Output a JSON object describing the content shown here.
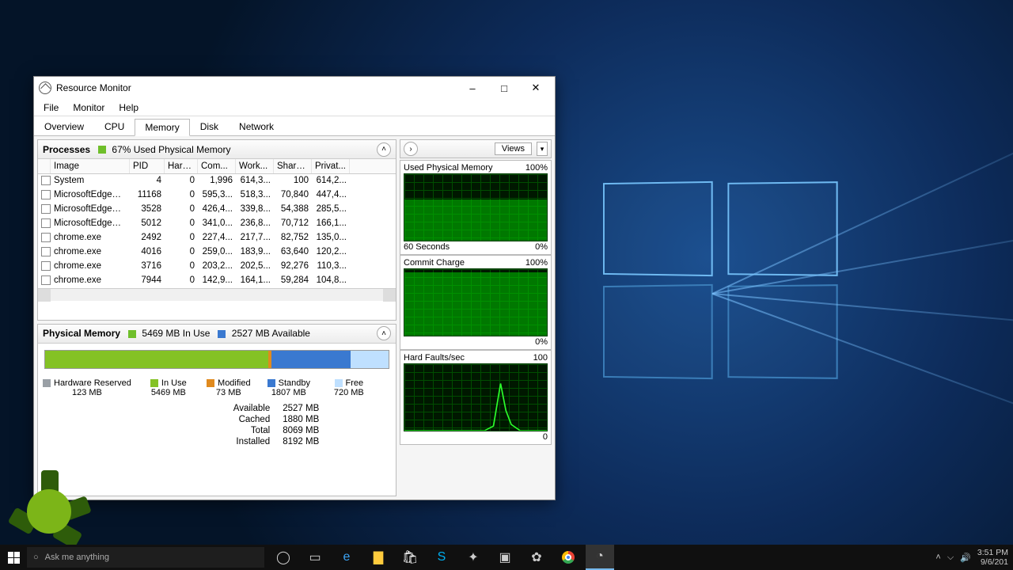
{
  "window": {
    "title": "Resource Monitor",
    "menu": [
      "File",
      "Monitor",
      "Help"
    ],
    "tabs": [
      "Overview",
      "CPU",
      "Memory",
      "Disk",
      "Network"
    ],
    "active_tab": 2,
    "controls": {
      "min": "–",
      "max": "□",
      "close": "✕"
    }
  },
  "processes_panel": {
    "title": "Processes",
    "summary": "67% Used Physical Memory",
    "badge_color": "#6fbf2a",
    "columns": [
      "Image",
      "PID",
      "Hard ...",
      "Com...",
      "Work...",
      "Share...",
      "Privat..."
    ],
    "rows": [
      {
        "img": "System",
        "pid": "4",
        "hard": "0",
        "com": "1,996",
        "work": "614,3...",
        "share": "100",
        "priv": "614,2..."
      },
      {
        "img": "MicrosoftEdgeCP.exe",
        "pid": "11168",
        "hard": "0",
        "com": "595,3...",
        "work": "518,3...",
        "share": "70,840",
        "priv": "447,4..."
      },
      {
        "img": "MicrosoftEdgeCP.exe",
        "pid": "3528",
        "hard": "0",
        "com": "426,4...",
        "work": "339,8...",
        "share": "54,388",
        "priv": "285,5..."
      },
      {
        "img": "MicrosoftEdgeCP.exe",
        "pid": "5012",
        "hard": "0",
        "com": "341,0...",
        "work": "236,8...",
        "share": "70,712",
        "priv": "166,1..."
      },
      {
        "img": "chrome.exe",
        "pid": "2492",
        "hard": "0",
        "com": "227,4...",
        "work": "217,7...",
        "share": "82,752",
        "priv": "135,0..."
      },
      {
        "img": "chrome.exe",
        "pid": "4016",
        "hard": "0",
        "com": "259,0...",
        "work": "183,9...",
        "share": "63,640",
        "priv": "120,2..."
      },
      {
        "img": "chrome.exe",
        "pid": "3716",
        "hard": "0",
        "com": "203,2...",
        "work": "202,5...",
        "share": "92,276",
        "priv": "110,3..."
      },
      {
        "img": "chrome.exe",
        "pid": "7944",
        "hard": "0",
        "com": "142,9...",
        "work": "164,1...",
        "share": "59,284",
        "priv": "104,8..."
      }
    ]
  },
  "physical_memory_panel": {
    "title": "Physical Memory",
    "in_use_label": "5469 MB In Use",
    "in_use_color": "#6fbf2a",
    "avail_label": "2527 MB Available",
    "avail_color": "#3a79d0",
    "segments": [
      {
        "color": "#9aa0a6",
        "pct": 0
      },
      {
        "color": "#84c225",
        "pct": 65
      },
      {
        "color": "#e08a1e",
        "pct": 1
      },
      {
        "color": "#3a79d0",
        "pct": 23
      },
      {
        "color": "#bfe0ff",
        "pct": 11
      }
    ],
    "legend": [
      {
        "name": "Hardware Reserved",
        "val": "123 MB",
        "color": "#9aa0a6"
      },
      {
        "name": "In Use",
        "val": "5469 MB",
        "color": "#84c225"
      },
      {
        "name": "Modified",
        "val": "73 MB",
        "color": "#e08a1e"
      },
      {
        "name": "Standby",
        "val": "1807 MB",
        "color": "#3a79d0"
      },
      {
        "name": "Free",
        "val": "720 MB",
        "color": "#bfe0ff"
      }
    ],
    "stats": [
      {
        "l": "Available",
        "v": "2527 MB"
      },
      {
        "l": "Cached",
        "v": "1880 MB"
      },
      {
        "l": "Total",
        "v": "8069 MB"
      },
      {
        "l": "Installed",
        "v": "8192 MB"
      }
    ]
  },
  "charts_panel": {
    "views_label": "Views",
    "charts": [
      {
        "title": "Used Physical Memory",
        "max": "100%",
        "footer_l": "60 Seconds",
        "footer_r": "0%",
        "style": "fill60"
      },
      {
        "title": "Commit Charge",
        "max": "100%",
        "footer_l": "",
        "footer_r": "0%",
        "style": "fill95"
      },
      {
        "title": "Hard Faults/sec",
        "max": "100",
        "footer_l": "",
        "footer_r": "0",
        "style": "spike"
      }
    ]
  },
  "taskbar": {
    "search_placeholder": "Ask me anything",
    "time": "3:51 PM",
    "date": "9/6/201"
  },
  "chart_data": [
    {
      "type": "area",
      "title": "Used Physical Memory",
      "ylabel": "%",
      "ylim": [
        0,
        100
      ],
      "x": "60 Seconds",
      "values": [
        62,
        62,
        62,
        62,
        62,
        62,
        62,
        62,
        62,
        62,
        62,
        62,
        62,
        62,
        62
      ]
    },
    {
      "type": "area",
      "title": "Commit Charge",
      "ylabel": "%",
      "ylim": [
        0,
        100
      ],
      "x": "60 Seconds",
      "values": [
        95,
        95,
        95,
        95,
        95,
        95,
        95,
        95,
        95,
        95,
        95,
        95,
        95,
        95,
        95
      ]
    },
    {
      "type": "line",
      "title": "Hard Faults/sec",
      "ylabel": "faults/sec",
      "ylim": [
        0,
        100
      ],
      "x": "60 Seconds",
      "values": [
        0,
        0,
        0,
        0,
        0,
        0,
        0,
        0,
        0,
        0,
        5,
        60,
        20,
        5,
        0
      ]
    }
  ]
}
